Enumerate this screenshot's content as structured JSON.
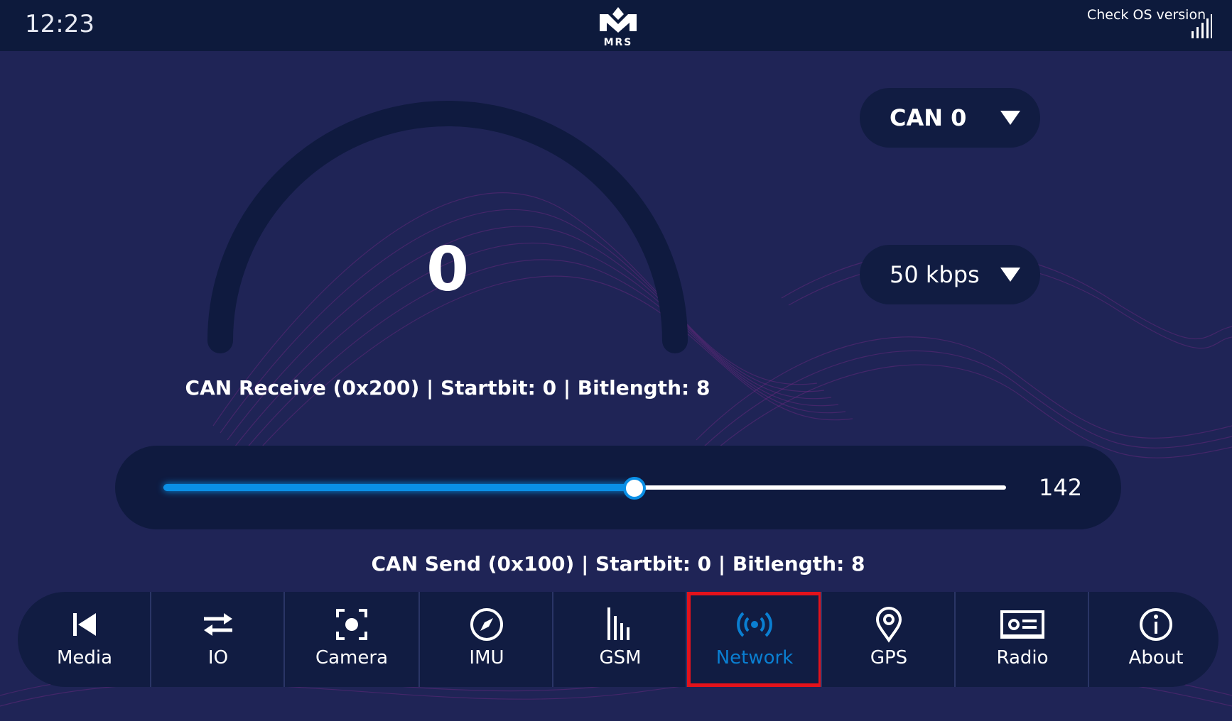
{
  "status_bar": {
    "time": "12:23",
    "logo_text": "MRS",
    "os_check_label": "Check OS version"
  },
  "gauge": {
    "value": "0",
    "level": 0,
    "receive_label": "CAN Receive (0x200) | Startbit: 0 | Bitlength: 8"
  },
  "can_select": {
    "selected": "CAN 0"
  },
  "baud_select": {
    "selected": "50 kbps"
  },
  "slider": {
    "value": "142",
    "min": 0,
    "max": 255,
    "fraction": 0.557,
    "send_label": "CAN Send (0x100) | Startbit: 0 | Bitlength: 8"
  },
  "nav": {
    "items": [
      {
        "label": "Media",
        "icon": "skip-previous-icon"
      },
      {
        "label": "IO",
        "icon": "swap-arrows-icon"
      },
      {
        "label": "Camera",
        "icon": "camera-focus-icon"
      },
      {
        "label": "IMU",
        "icon": "compass-icon"
      },
      {
        "label": "GSM",
        "icon": "bars-icon"
      },
      {
        "label": "Network",
        "icon": "broadcast-icon",
        "active": true
      },
      {
        "label": "GPS",
        "icon": "map-pin-icon"
      },
      {
        "label": "Radio",
        "icon": "radio-icon"
      },
      {
        "label": "About",
        "icon": "info-icon"
      }
    ]
  },
  "colors": {
    "background": "#1f2456",
    "topbar": "#0d1a3c",
    "panel": "#111c42",
    "accent_blue": "#0a8fe6",
    "highlight_red": "#e3121b"
  }
}
